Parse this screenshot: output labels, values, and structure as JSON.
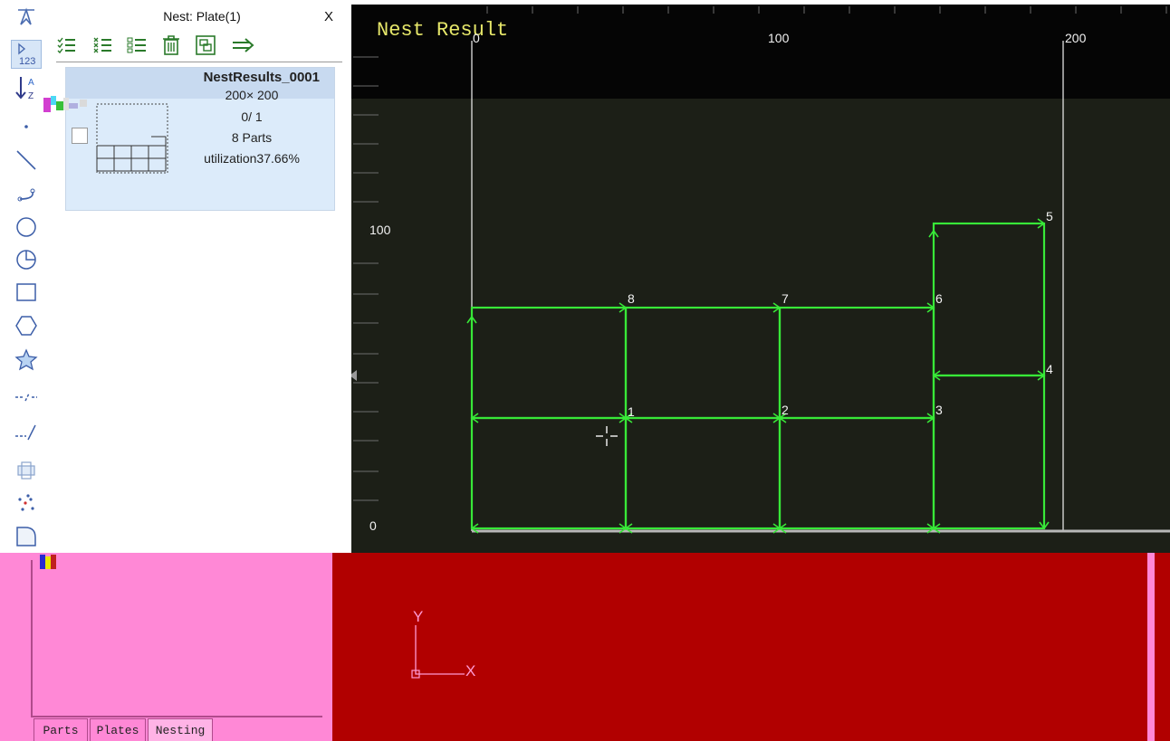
{
  "panel": {
    "title": "Nest: Plate(1)",
    "close_label": "X",
    "toolbar": [
      "select-all-icon",
      "deselect-all-icon",
      "list-icon",
      "delete-icon",
      "export-icon",
      "next-icon"
    ]
  },
  "result": {
    "name": "NestResults_0001",
    "size": "200× 200",
    "count": "0/  1",
    "parts": "8 Parts",
    "utilization": "utilization37.66%"
  },
  "canvas": {
    "title": "Nest Result",
    "x_ticks": [
      "0",
      "100",
      "200"
    ],
    "y_ticks": [
      "100",
      "0"
    ],
    "part_labels": [
      "1",
      "2",
      "3",
      "4",
      "5",
      "6",
      "7",
      "8"
    ],
    "accent": "#38e838",
    "grid_color": "#f2f2f2"
  },
  "ucs": {
    "y_label": "Y",
    "x_label": "X"
  },
  "tabs": [
    "Parts",
    "Plates",
    "Nesting"
  ],
  "vtools": [
    "select-icon",
    "number-sort-icon",
    "alpha-sort-icon",
    "point-icon",
    "line-icon",
    "arc-icon",
    "circle-icon",
    "pie-icon",
    "rectangle-icon",
    "hexagon-icon",
    "star-icon",
    "dash-line-icon",
    "dash-slash-icon",
    "copy-icon",
    "scatter-icon",
    "fillet-icon"
  ]
}
